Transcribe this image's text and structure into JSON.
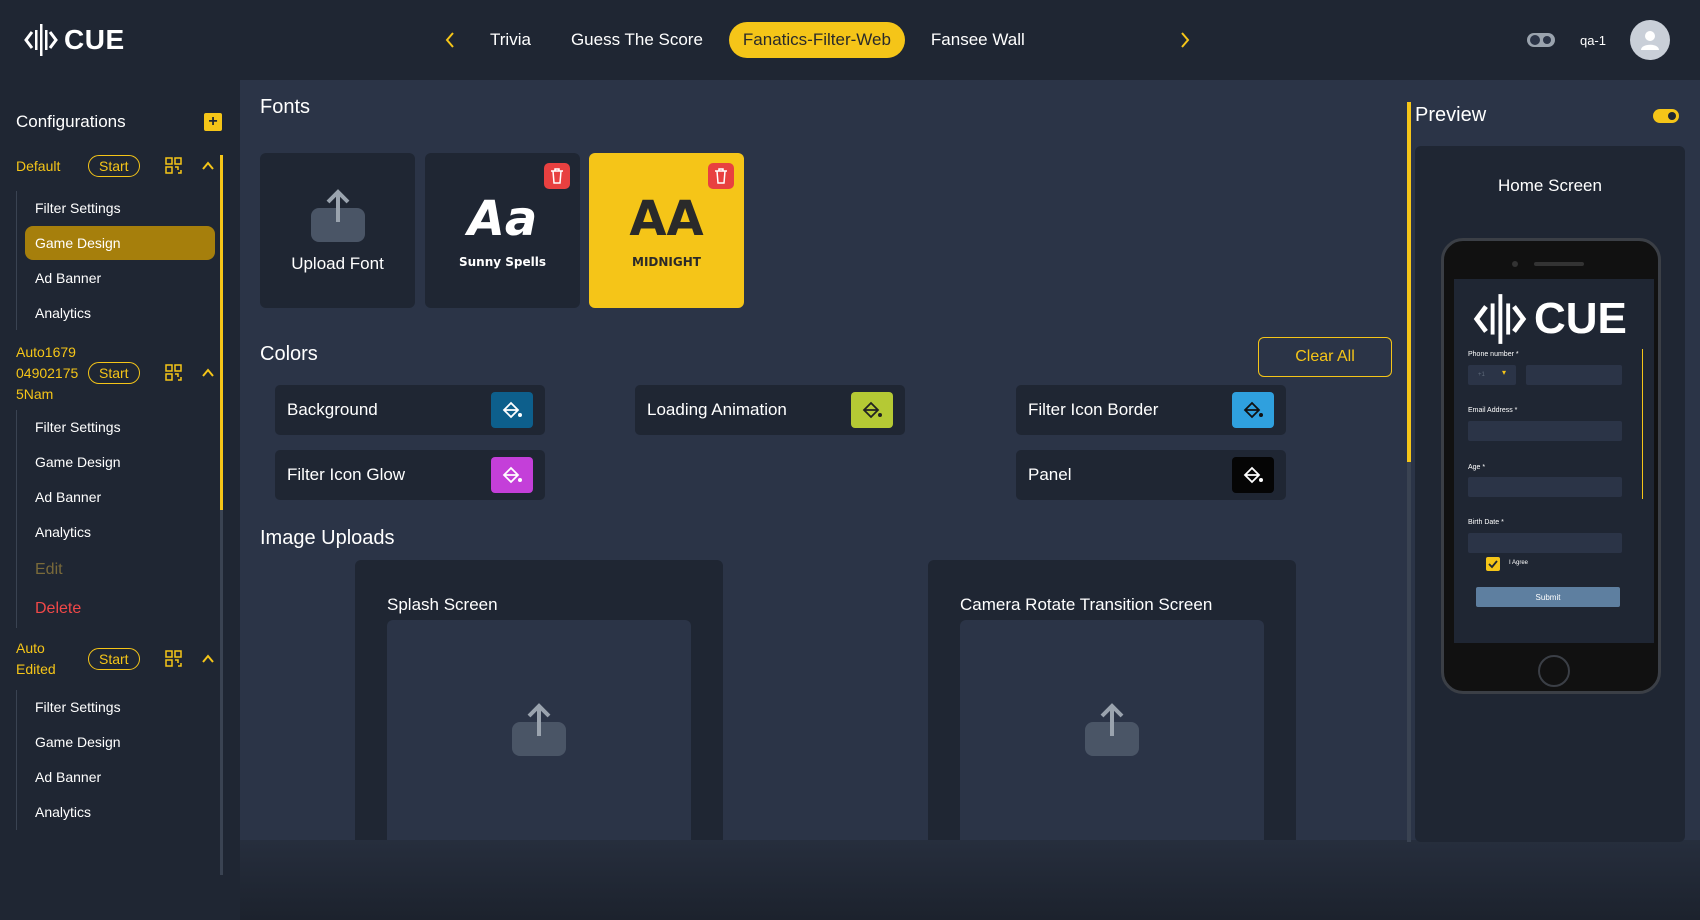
{
  "app": {
    "logo_text": "CUE"
  },
  "nav": {
    "tabs": [
      "Trivia",
      "Guess The Score",
      "Fanatics-Filter-Web",
      "Fansee Wall"
    ],
    "active": "Fanatics-Filter-Web"
  },
  "user": {
    "name": "qa-1"
  },
  "sidebar": {
    "title": "Configurations",
    "configs": [
      {
        "name": "Default",
        "start_label": "Start",
        "items": [
          "Filter Settings",
          "Game Design",
          "Ad Banner",
          "Analytics"
        ],
        "active_item": "Game Design"
      },
      {
        "name": "Auto1679 04902175 5Nam",
        "name_lines": [
          "Auto1679",
          "04902175",
          "5Nam"
        ],
        "start_label": "Start",
        "items": [
          "Filter Settings",
          "Game Design",
          "Ad Banner",
          "Analytics"
        ],
        "edit_label": "Edit",
        "delete_label": "Delete"
      },
      {
        "name": "Auto Edited",
        "name_lines": [
          "Auto",
          "Edited"
        ],
        "start_label": "Start",
        "items": [
          "Filter Settings",
          "Game Design",
          "Ad Banner",
          "Analytics"
        ]
      }
    ]
  },
  "fonts": {
    "title": "Fonts",
    "upload_label": "Upload Font",
    "cards": [
      {
        "preview": "Aa",
        "name": "Sunny Spells"
      },
      {
        "preview": "AA",
        "name": "MIDNIGHT",
        "selected": true
      }
    ]
  },
  "colors": {
    "title": "Colors",
    "clear_label": "Clear All",
    "items": [
      {
        "label": "Background",
        "color": "#0d5f8c"
      },
      {
        "label": "Loading Animation",
        "color": "#b5c934"
      },
      {
        "label": "Filter Icon Border",
        "color": "#2fa0de"
      },
      {
        "label": "Filter Icon Glow",
        "color": "#c43fd9"
      },
      {
        "label": "Panel",
        "color": "#050505"
      }
    ]
  },
  "images": {
    "title": "Image Uploads",
    "cards": [
      "Splash Screen",
      "Camera Rotate Transition Screen"
    ]
  },
  "preview": {
    "title": "Preview",
    "screen_title": "Home Screen",
    "phone": {
      "logo_text": "CUE",
      "fields": [
        "Phone number *",
        "Email Address *",
        "Age *",
        "Birth Date *"
      ],
      "country_code": "+1",
      "agree_label": "I Agree",
      "submit_label": "Submit"
    }
  },
  "theme": {
    "accent": "#f5c518",
    "bg_dark": "#1f2633",
    "bg_main": "#2b3447",
    "danger": "#e84040"
  }
}
